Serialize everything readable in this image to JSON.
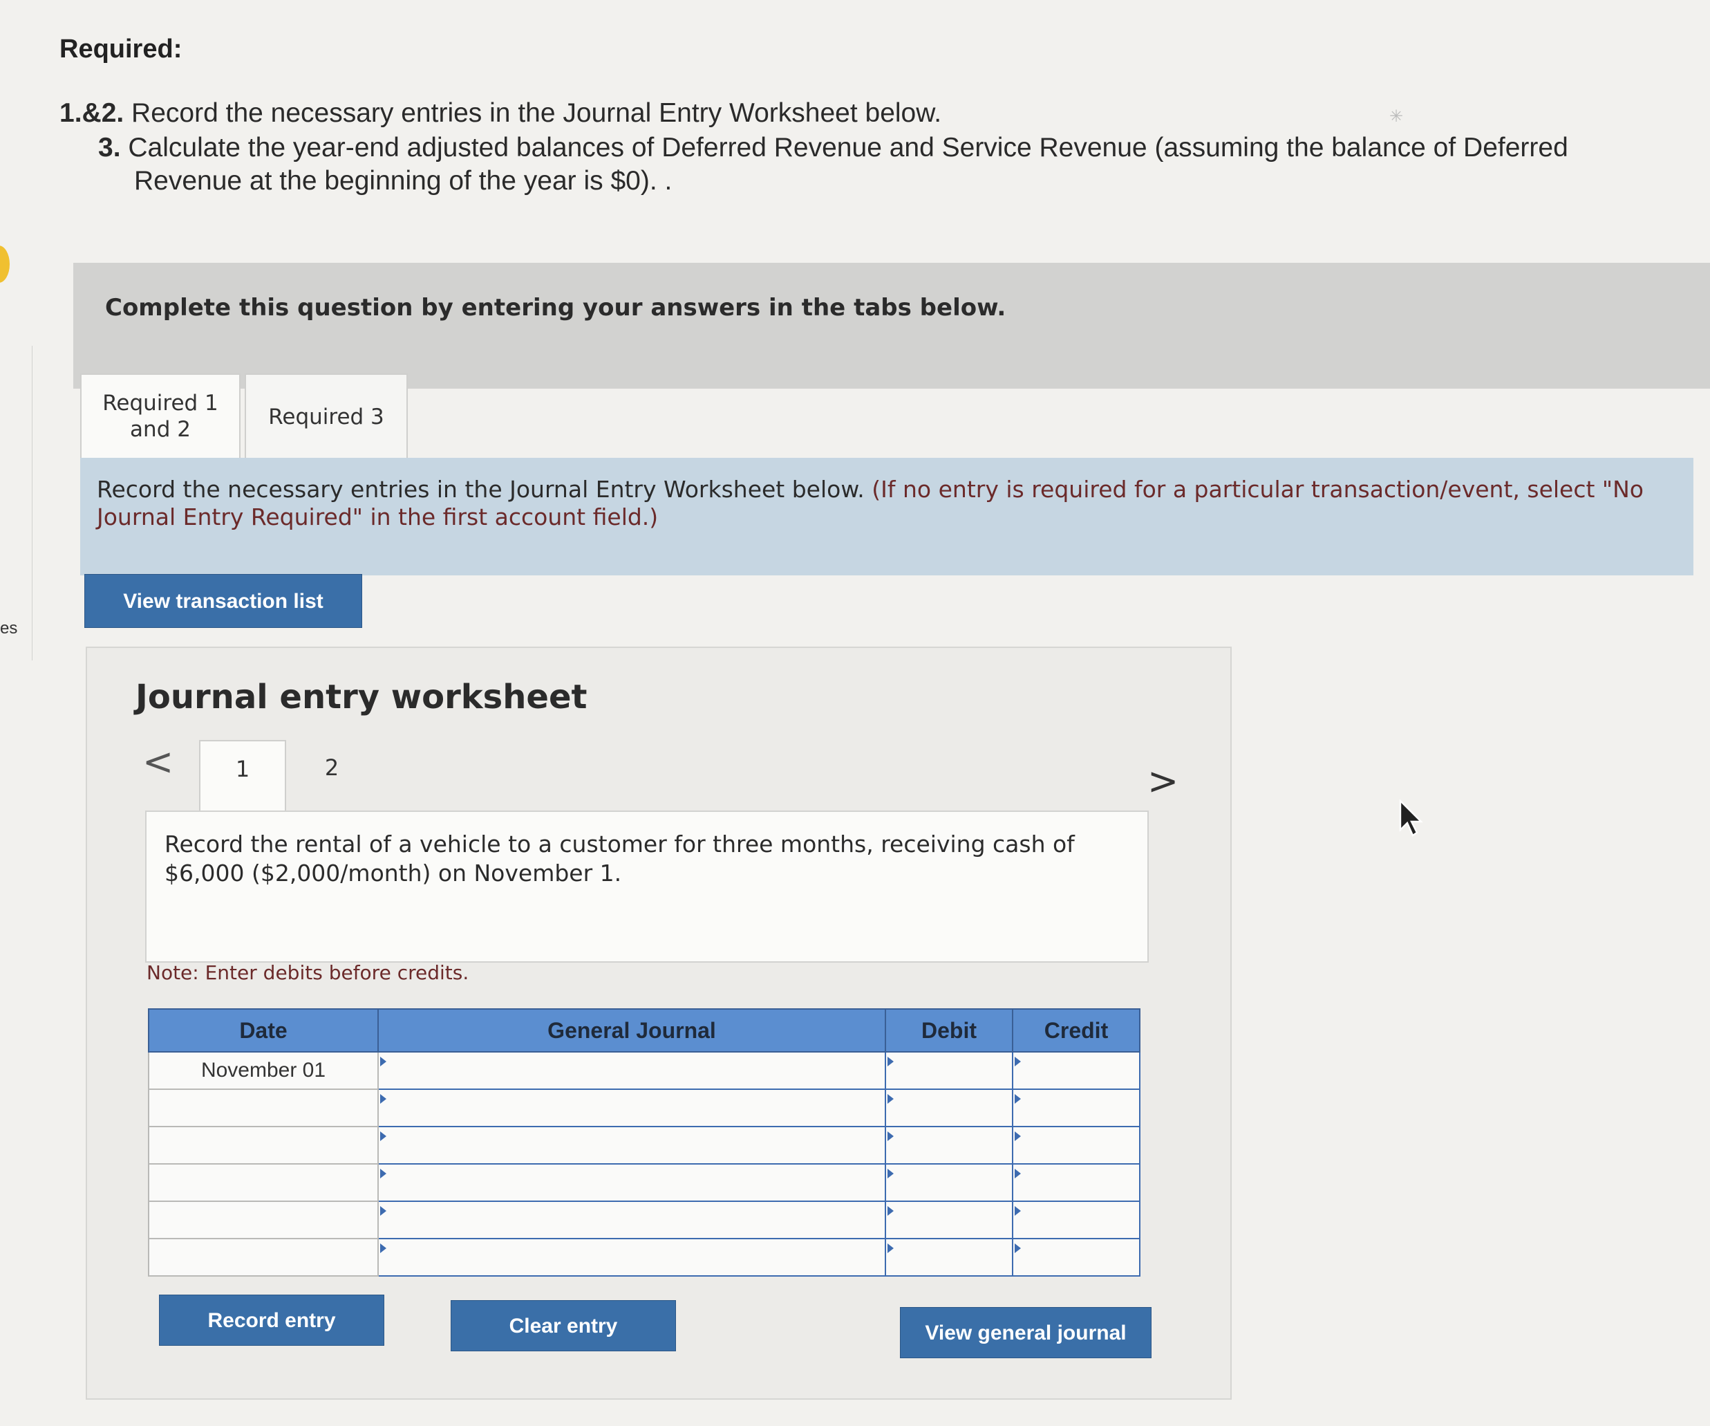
{
  "edge": {
    "text": "es"
  },
  "header": {
    "title": "Required:",
    "line1_num": "1.&2.",
    "line1_text": " Record the necessary entries in the Journal Entry Worksheet below.",
    "line2_num": "3.",
    "line2_text": " Calculate the year-end adjusted balances of Deferred Revenue and Service Revenue (assuming the balance of Deferred",
    "line3_text": "Revenue at the beginning of the year is $0). ."
  },
  "banner": {
    "text": "Complete this question by entering your answers in the tabs below."
  },
  "tabs": [
    {
      "label_line1": "Required 1",
      "label_line2": "and 2"
    },
    {
      "label": "Required 3"
    }
  ],
  "instructions": {
    "text": "Record the necessary entries in the Journal Entry Worksheet below.",
    "note": "(If no entry is required for a particular transaction/event, select \"No Journal Entry Required\" in the first account field.)"
  },
  "buttons": {
    "view_transactions": "View transaction list",
    "record_entry": "Record entry",
    "clear_entry": "Clear entry",
    "view_general_journal": "View general journal"
  },
  "worksheet": {
    "title": "Journal entry worksheet",
    "prev": "<",
    "next": ">",
    "pages": [
      "1",
      "2"
    ],
    "prompt": "Record the rental of a vehicle to a customer for three months, receiving cash of $6,000 ($2,000/month) on November 1.",
    "note": "Note: Enter debits before credits.",
    "table": {
      "headers": [
        "Date",
        "General Journal",
        "Debit",
        "Credit"
      ],
      "rows": [
        {
          "date": "November 01",
          "account": "",
          "debit": "",
          "credit": ""
        },
        {
          "date": "",
          "account": "",
          "debit": "",
          "credit": ""
        },
        {
          "date": "",
          "account": "",
          "debit": "",
          "credit": ""
        },
        {
          "date": "",
          "account": "",
          "debit": "",
          "credit": ""
        },
        {
          "date": "",
          "account": "",
          "debit": "",
          "credit": ""
        },
        {
          "date": "",
          "account": "",
          "debit": "",
          "credit": ""
        }
      ]
    }
  }
}
